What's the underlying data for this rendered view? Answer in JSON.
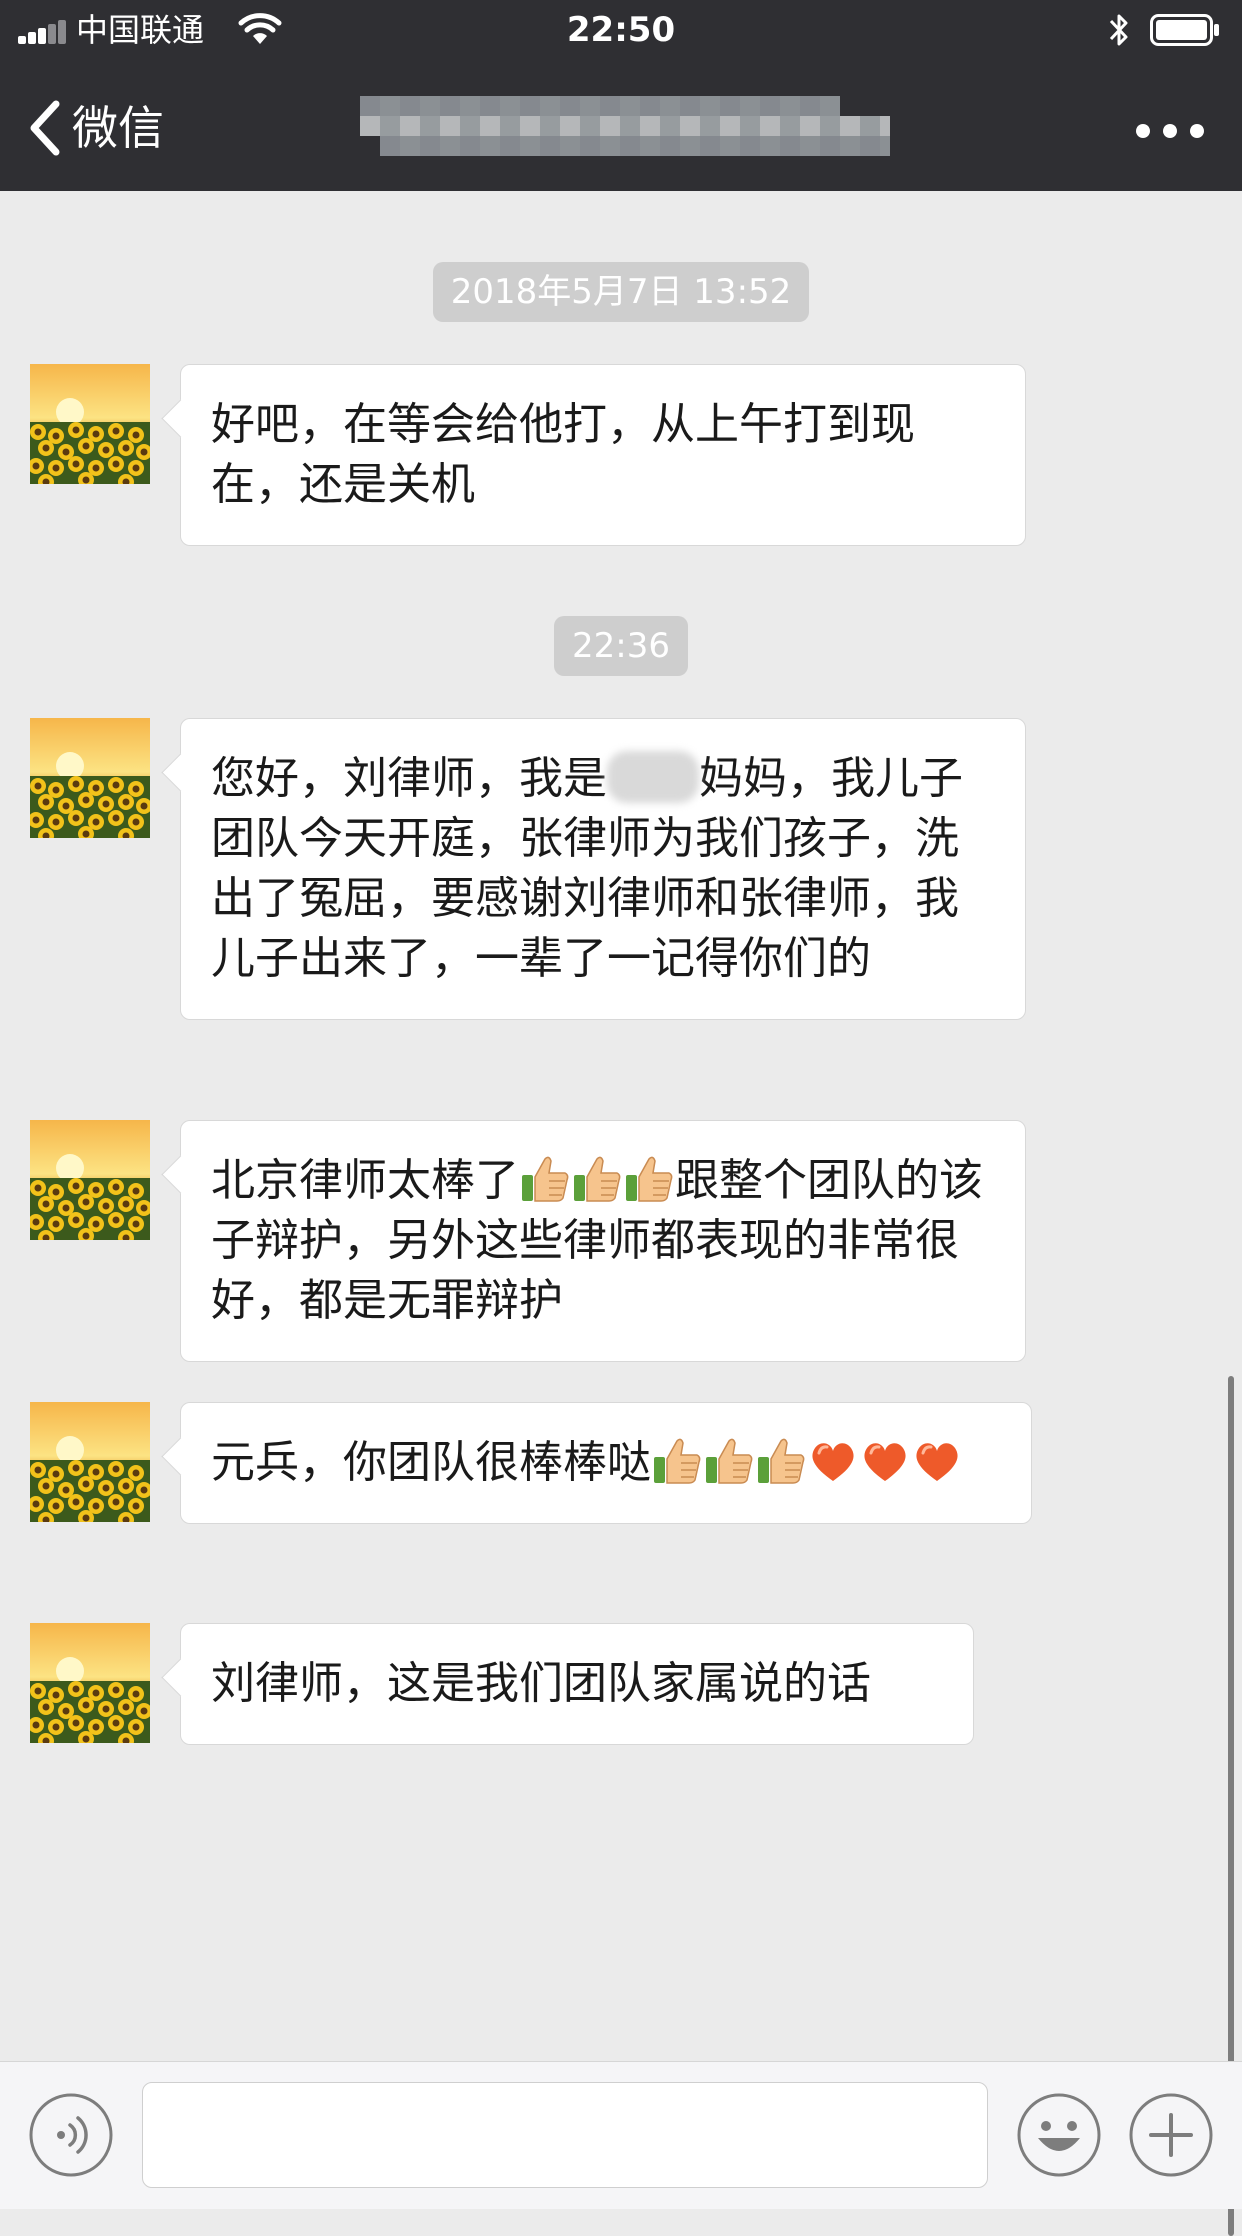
{
  "status_bar": {
    "carrier": "中国联通",
    "time": "22:50",
    "signal_bars_filled": 3,
    "signal_bars_total": 5
  },
  "nav": {
    "back_label": "微信",
    "title": "",
    "icons": {
      "back": "chevron-left-icon",
      "more": "more-dots-icon"
    }
  },
  "chat": {
    "timestamps": [
      "2018年5月7日 13:52",
      "22:36"
    ],
    "messages": [
      {
        "segments": [
          {
            "type": "text",
            "value": "好吧，在等会给他打，从上午打到现在，还是关机"
          }
        ]
      },
      {
        "segments": [
          {
            "type": "text",
            "value": "您好，刘律师，我是"
          },
          {
            "type": "blur",
            "value": ""
          },
          {
            "type": "text",
            "value": "妈妈，我儿子团队今天开庭，张律师为我们孩子，洗出了冤屈，要感谢刘律师和张律师，我儿子出来了，一辈了一记得你们的"
          }
        ]
      },
      {
        "segments": [
          {
            "type": "text",
            "value": "北京律师太棒了"
          },
          {
            "type": "emoji",
            "value": "thumbs-up"
          },
          {
            "type": "emoji",
            "value": "thumbs-up"
          },
          {
            "type": "emoji",
            "value": "thumbs-up"
          },
          {
            "type": "text",
            "value": "跟整个团队的该子辩护，另外这些律师都表现的非常很好，都是无罪辩护"
          }
        ]
      },
      {
        "segments": [
          {
            "type": "text",
            "value": "元兵，你团队很棒棒哒"
          },
          {
            "type": "emoji",
            "value": "thumbs-up"
          },
          {
            "type": "emoji",
            "value": "thumbs-up"
          },
          {
            "type": "emoji",
            "value": "thumbs-up"
          },
          {
            "type": "emoji",
            "value": "heart"
          },
          {
            "type": "emoji",
            "value": "heart"
          },
          {
            "type": "emoji",
            "value": "heart"
          }
        ]
      },
      {
        "segments": [
          {
            "type": "text",
            "value": "刘律师，这是我们团队家属说的话"
          }
        ]
      }
    ]
  },
  "input_bar": {
    "text_value": "",
    "icons": {
      "voice": "voice-icon",
      "emoji": "emoji-icon",
      "more": "plus-icon"
    }
  },
  "colors": {
    "nav_background": "#2f2f33",
    "chat_background": "#ebebeb",
    "bubble_background": "#ffffff",
    "timestamp_pill": "#cecece"
  }
}
